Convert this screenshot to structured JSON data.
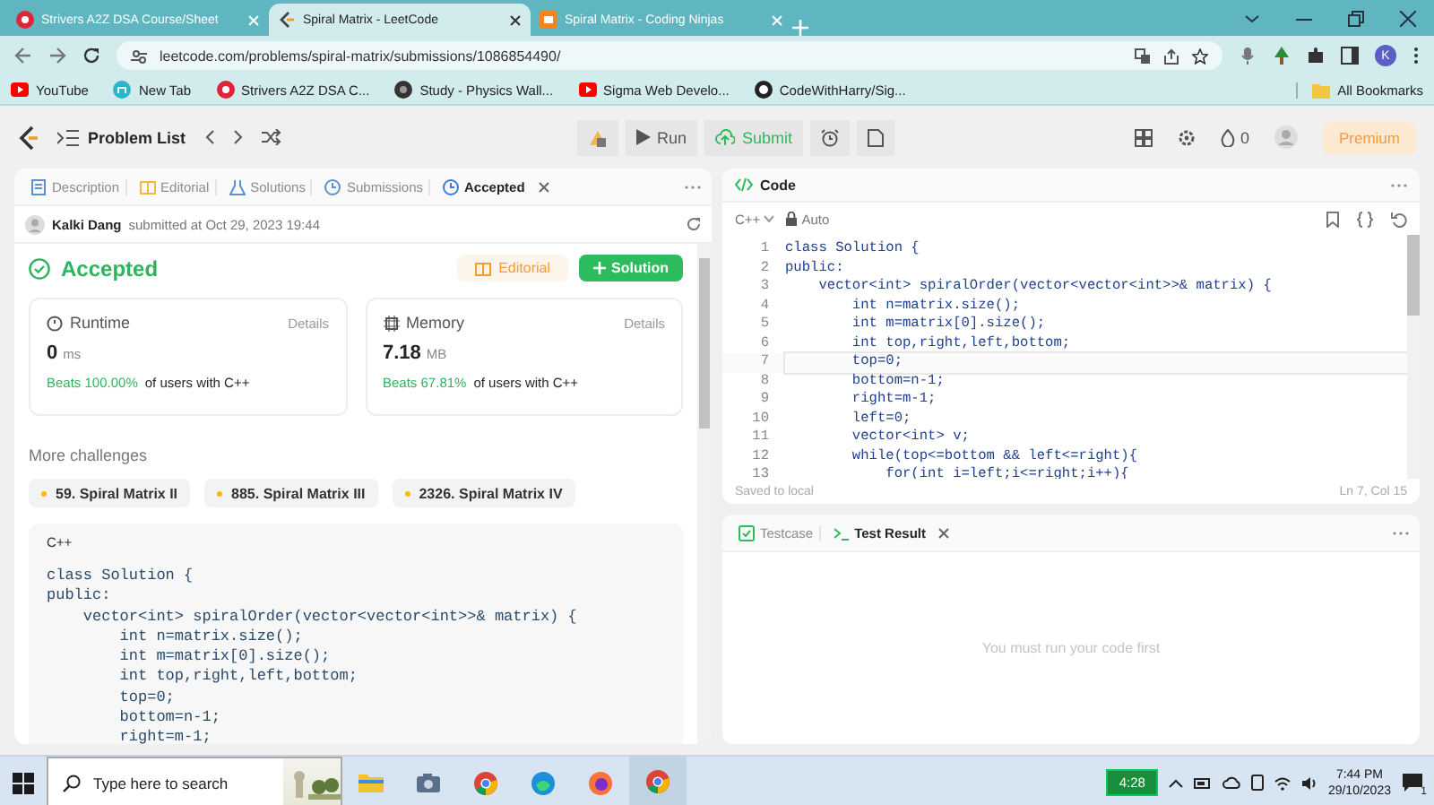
{
  "browser": {
    "tabs": [
      {
        "title": "Strivers A2Z DSA Course/Sheet",
        "kind": "striver",
        "selected": false
      },
      {
        "title": "Spiral Matrix - LeetCode",
        "kind": "leetcode",
        "selected": true
      },
      {
        "title": "Spiral Matrix - Coding Ninjas",
        "kind": "ninjas",
        "selected": false
      }
    ],
    "url": "leetcode.com/problems/spiral-matrix/submissions/1086854490/",
    "profile_initial": "K",
    "bookmarks": [
      {
        "label": "YouTube",
        "kind": "youtube"
      },
      {
        "label": "New Tab",
        "kind": "newtab"
      },
      {
        "label": "Strivers A2Z DSA C...",
        "kind": "striver"
      },
      {
        "label": "Study - Physics Wall...",
        "kind": "study"
      },
      {
        "label": "Sigma Web Develo...",
        "kind": "youtube"
      },
      {
        "label": "CodeWithHarry/Sig...",
        "kind": "github"
      }
    ],
    "all_bookmarks": "All Bookmarks"
  },
  "leetcode_nav": {
    "problem_list": "Problem List",
    "run": "Run",
    "submit": "Submit",
    "streak": "0",
    "premium": "Premium"
  },
  "left_panel": {
    "tabs": [
      {
        "label": "Description",
        "kind": "description",
        "selected": false
      },
      {
        "label": "Editorial",
        "kind": "editorial",
        "selected": false
      },
      {
        "label": "Solutions",
        "kind": "solutions",
        "selected": false
      },
      {
        "label": "Submissions",
        "kind": "submissions",
        "selected": false
      },
      {
        "label": "Accepted",
        "kind": "accepted",
        "selected": true
      }
    ],
    "submitter": "Kalki Dang",
    "submitted_at": "submitted at Oct 29, 2023 19:44",
    "status": "Accepted",
    "editorial_button": "Editorial",
    "solution_button": "Solution",
    "metrics": [
      {
        "kind": "runtime",
        "label": "Runtime",
        "details": "Details",
        "value": "0",
        "unit": "ms",
        "beats": "Beats 100.00%",
        "suffix": "of users with C++"
      },
      {
        "kind": "memory",
        "label": "Memory",
        "details": "Details",
        "value": "7.18",
        "unit": "MB",
        "beats": "Beats 67.81%",
        "suffix": "of users with C++"
      }
    ],
    "more_challenges": "More challenges",
    "challenges": [
      {
        "title": "59. Spiral Matrix II",
        "color": "#ffb800"
      },
      {
        "title": "885. Spiral Matrix III",
        "color": "#ffb800"
      },
      {
        "title": "2326. Spiral Matrix IV",
        "color": "#ffb800"
      }
    ],
    "code_block": {
      "language": "C++",
      "lines": [
        "class Solution {",
        "public:",
        "    vector<int> spiralOrder(vector<vector<int>>& matrix) {",
        "        int n=matrix.size();",
        "        int m=matrix[0].size();",
        "        int top,right,left,bottom;",
        "        top=0;",
        "        bottom=n-1;",
        "        right=m-1;"
      ]
    }
  },
  "right_panel": {
    "title": "Code",
    "language": "C++",
    "mode": "Auto",
    "lines": [
      {
        "number": "1",
        "text": "class Solution {",
        "current": false
      },
      {
        "number": "2",
        "text": "public:",
        "current": false
      },
      {
        "number": "3",
        "text": "    vector<int> spiralOrder(vector<vector<int>>& matrix) {",
        "current": false
      },
      {
        "number": "4",
        "text": "        int n=matrix.size();",
        "current": false
      },
      {
        "number": "5",
        "text": "        int m=matrix[0].size();",
        "current": false
      },
      {
        "number": "6",
        "text": "        int top,right,left,bottom;",
        "current": false
      },
      {
        "number": "7",
        "text": "        top=0;",
        "current": true
      },
      {
        "number": "8",
        "text": "        bottom=n-1;",
        "current": false
      },
      {
        "number": "9",
        "text": "        right=m-1;",
        "current": false
      },
      {
        "number": "10",
        "text": "        left=0;",
        "current": false
      },
      {
        "number": "11",
        "text": "        vector<int> v;",
        "current": false
      },
      {
        "number": "12",
        "text": "        while(top<=bottom && left<=right){",
        "current": false
      },
      {
        "number": "13",
        "text": "            for(int i=left;i<=right;i++){",
        "current": false
      }
    ],
    "saved": "Saved to local",
    "cursor": "Ln 7, Col 15",
    "bottom_tabs": [
      {
        "label": "Testcase",
        "kind": "testcase",
        "selected": false
      },
      {
        "label": "Test Result",
        "kind": "result",
        "selected": true
      }
    ],
    "message": "You must run your code first"
  },
  "taskbar": {
    "search_placeholder": "Type here to search",
    "apps": [
      {
        "kind": "explorer",
        "selected": false
      },
      {
        "kind": "camera",
        "selected": false
      },
      {
        "kind": "chrome",
        "selected": false
      },
      {
        "kind": "edge",
        "selected": false
      },
      {
        "kind": "firefox",
        "selected": false
      },
      {
        "kind": "chrome",
        "selected": true
      }
    ],
    "battery": "4:28",
    "time": "7:44 PM",
    "date": "29/10/2023",
    "notifications": "1"
  }
}
